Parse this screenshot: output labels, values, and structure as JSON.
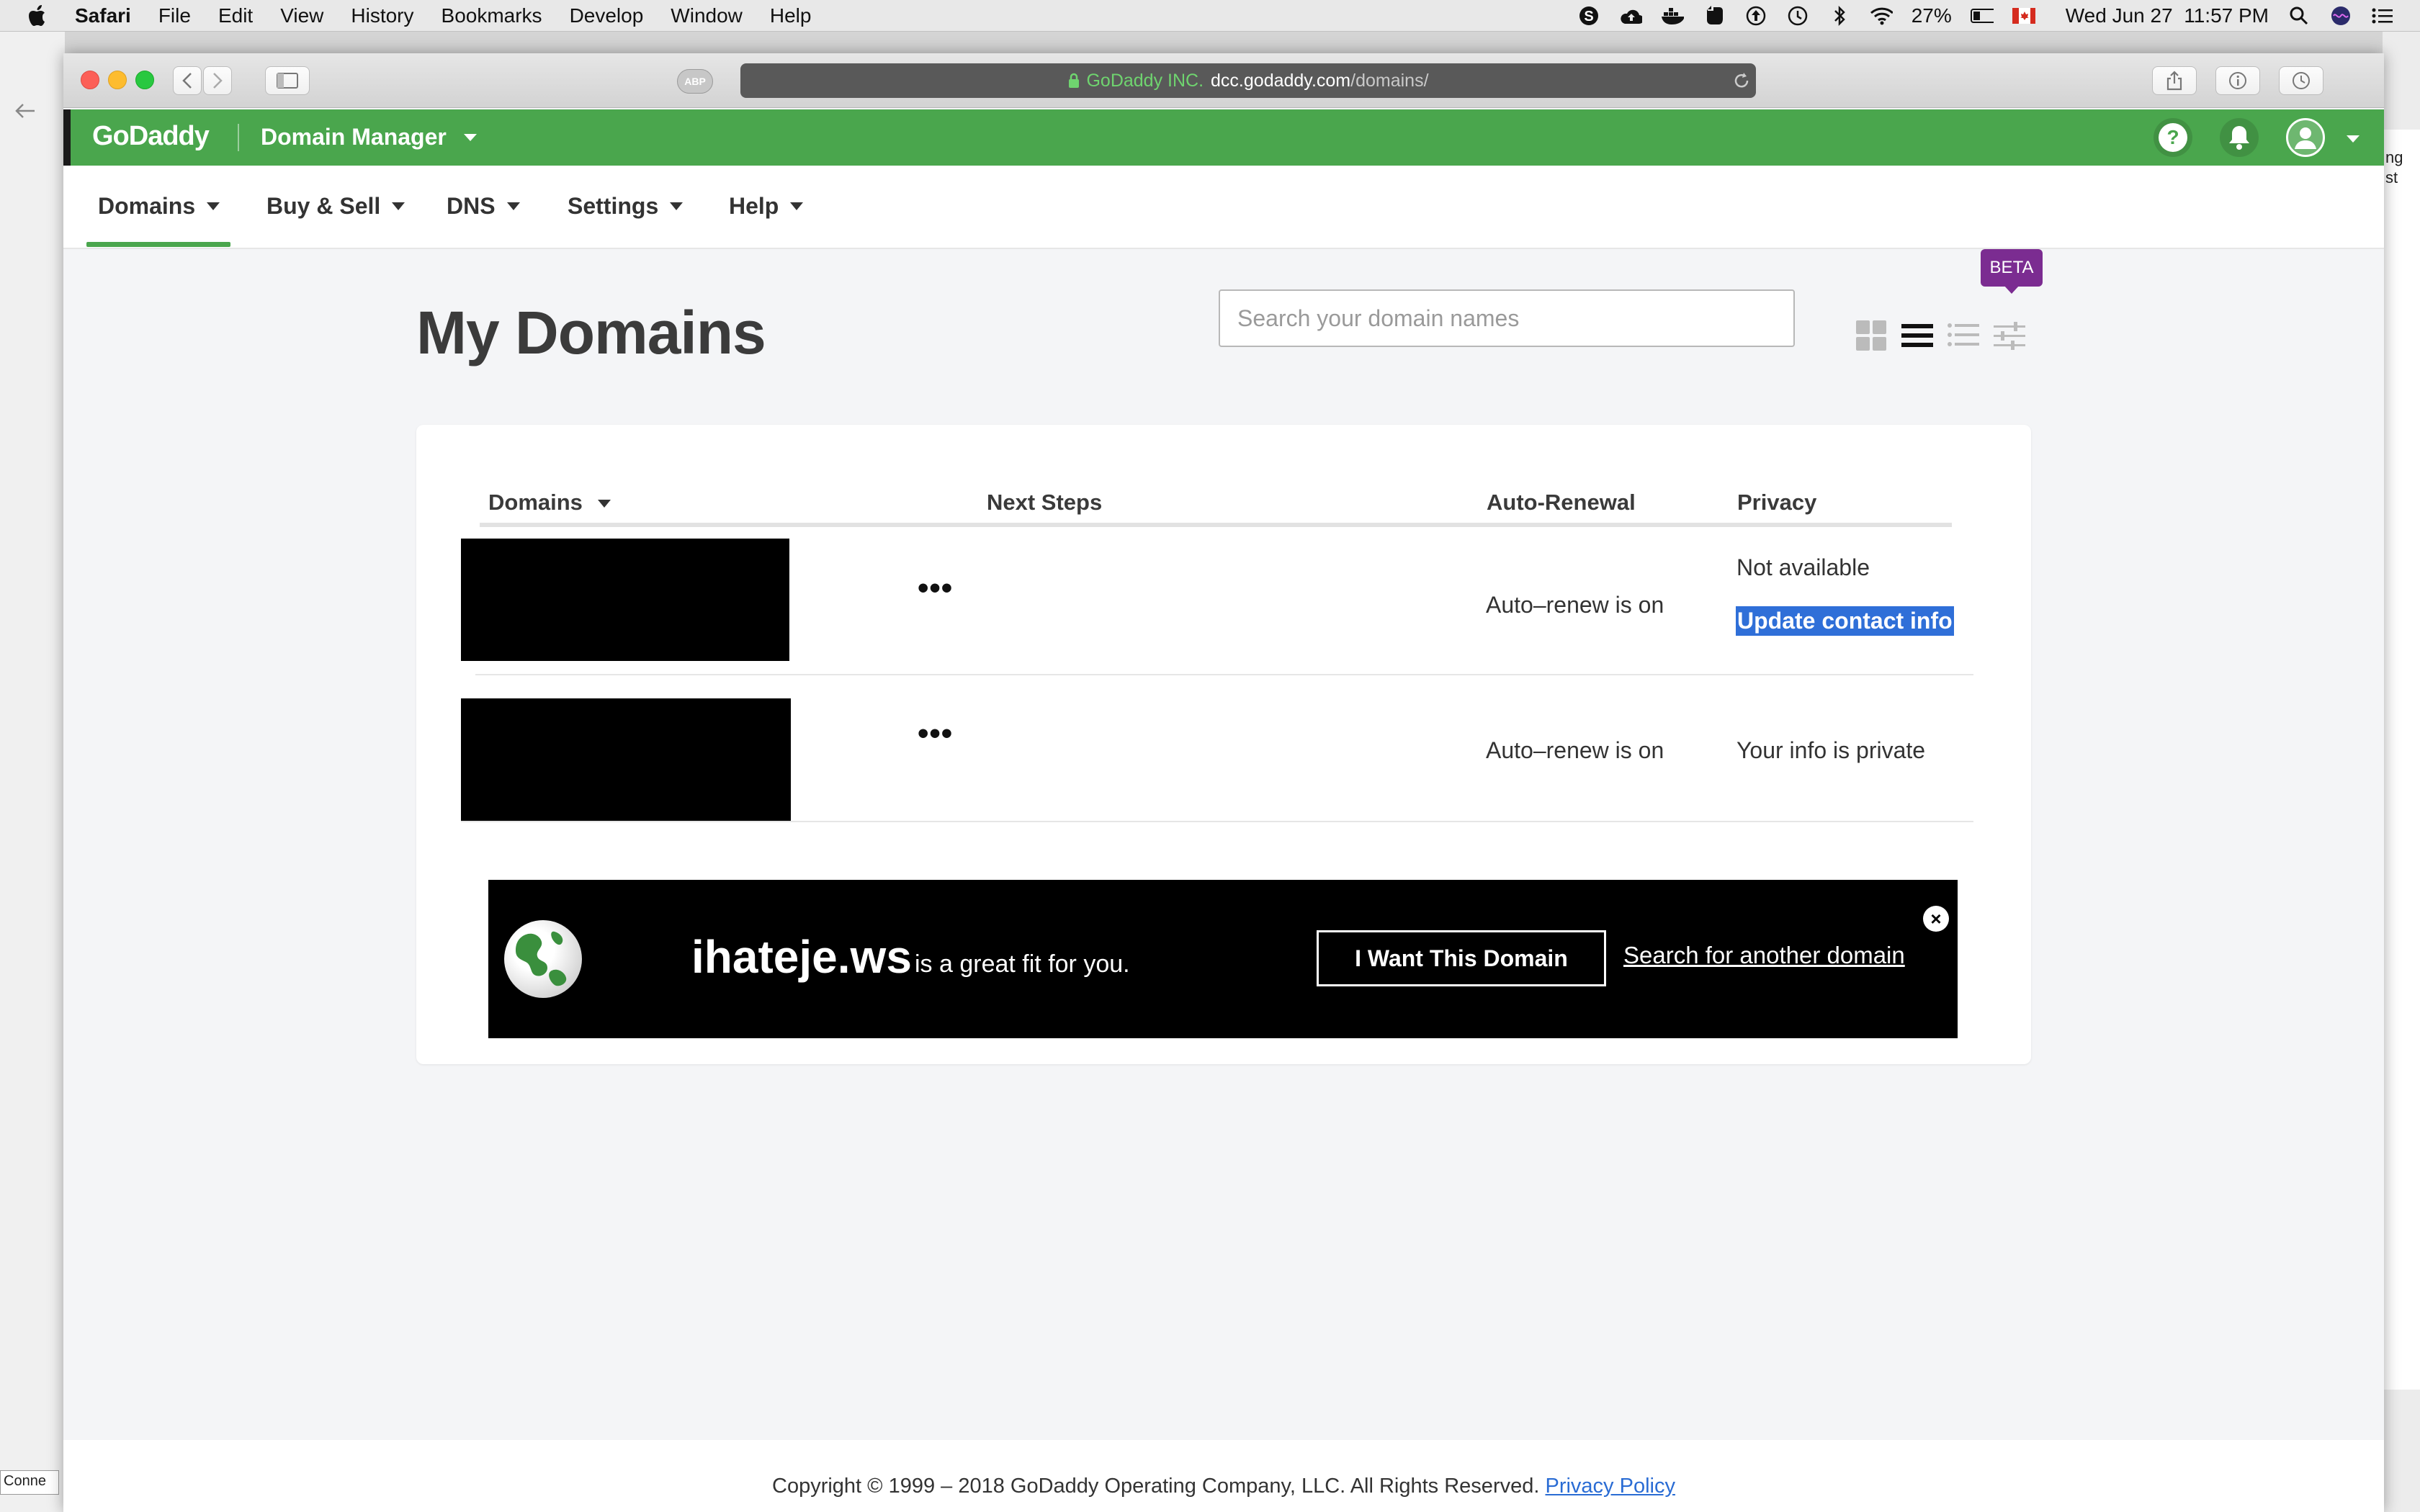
{
  "menubar": {
    "app": "Safari",
    "items": [
      "File",
      "Edit",
      "View",
      "History",
      "Bookmarks",
      "Develop",
      "Window",
      "Help"
    ],
    "battery": "27%",
    "clock": "Wed Jun 27  11:57 PM"
  },
  "browser": {
    "secure_label": "GoDaddy INC.",
    "url_host": "dcc.godaddy.com",
    "url_path": "/domains/",
    "abp_label": "ABP"
  },
  "header": {
    "logo": "GoDaddy",
    "title": "Domain Manager"
  },
  "nav": {
    "items": [
      "Domains",
      "Buy & Sell",
      "DNS",
      "Settings",
      "Help"
    ],
    "active": "Domains"
  },
  "main": {
    "title": "My Domains",
    "search_placeholder": "Search your domain names",
    "beta_label": "BETA"
  },
  "table": {
    "columns": [
      "Domains",
      "Next Steps",
      "Auto-Renewal",
      "Privacy"
    ],
    "rows": [
      {
        "next_steps": "•••",
        "auto_renewal": "Auto–renew is on",
        "privacy": "Not available",
        "privacy_link": "Update contact info"
      },
      {
        "next_steps": "•••",
        "auto_renewal": "Auto–renew is on",
        "privacy": "Your info is private"
      }
    ]
  },
  "promo": {
    "domain": "ihateje.ws",
    "text": "is a great fit for you.",
    "cta": "I Want This Domain",
    "link": "Search for another domain",
    "close": "×"
  },
  "footer": {
    "copyright": "Copyright © 1999 – 2018 GoDaddy Operating Company, LLC. All Rights Reserved.",
    "privacy_link": "Privacy Policy"
  },
  "background": {
    "status_text": "Conne",
    "side_text_1": "ng",
    "side_text_2": "st"
  },
  "colors": {
    "brand_green": "#4aa64d",
    "beta_purple": "#7b2c91",
    "link_blue": "#2a6cd4",
    "selection_blue": "#2f6fd8"
  }
}
